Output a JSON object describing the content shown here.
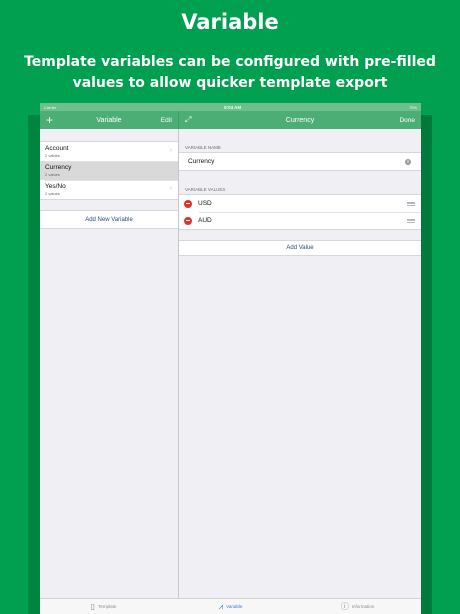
{
  "promo": {
    "title": "Variable",
    "subtitle": "Template variables can be configured with pre-filled values to allow quicker template export"
  },
  "statusbar": {
    "carrier": "Carrier",
    "time": "8:04 AM",
    "battery": "75%"
  },
  "navbar": {
    "left_title": "Variable",
    "add_icon": "plus-icon",
    "edit_label": "Edit",
    "right_title": "Currency",
    "expand_icon": "expand-arrows-icon",
    "done_label": "Done"
  },
  "variables": {
    "items": [
      {
        "name": "Account",
        "count": "2 values",
        "selected": false
      },
      {
        "name": "Currency",
        "count": "2 values",
        "selected": true
      },
      {
        "name": "Yes/No",
        "count": "2 values",
        "selected": false
      }
    ],
    "add_label": "Add New Variable"
  },
  "detail": {
    "name_section": "VARIABLE NAME",
    "name_value": "Currency",
    "values_section": "VARIABLE VALUES",
    "values": [
      "USD",
      "AUD"
    ],
    "add_label": "Add Value"
  },
  "tabbar": {
    "tabs": [
      {
        "label": "Template",
        "icon": "document-icon",
        "active": false
      },
      {
        "label": "Variable",
        "icon": "variable-icon",
        "active": true
      },
      {
        "label": "Information",
        "icon": "info-icon",
        "active": false
      }
    ]
  },
  "colors": {
    "brand_green": "#00a050",
    "nav_green": "#4cae74",
    "delete_red": "#e0322b",
    "link_blue": "#2b4f75"
  }
}
